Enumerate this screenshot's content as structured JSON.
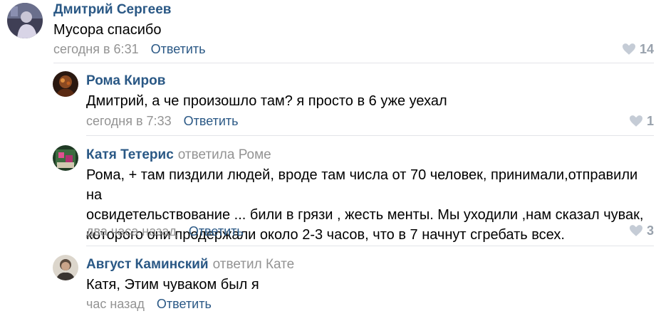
{
  "colors": {
    "author_link": "#2a5885",
    "meta_gray": "#939393",
    "like_gray": "#99a2ad",
    "divider": "#e3e4e8"
  },
  "comments": [
    {
      "author": "Дмитрий Сергеев",
      "reply_to": "",
      "text": "Мусора спасибо",
      "time": "сегодня в 6:31",
      "reply_label": "Ответить",
      "likes": "14",
      "avatar_icon": "user-avatar"
    },
    {
      "author": "Рома Киров",
      "reply_to": "",
      "text": "Дмитрий, а че произошло там? я просто в 6 уже уехал",
      "time": "сегодня в 7:33",
      "reply_label": "Ответить",
      "likes": "1",
      "avatar_icon": "user-avatar"
    },
    {
      "author": "Катя Тетерис",
      "reply_to": "ответила Роме",
      "text_lines": [
        "Рома, + там пиздили людей, вроде там числа от 70 человек, принимали,отправили на",
        "освидетельствование ... били в грязи , жесть менты. Мы уходили ,нам сказал чувак,",
        "которого они продержали около 2-3 часов, что в 7 начнут сгребать всех."
      ],
      "time": "два часа назад",
      "reply_label": "Ответить",
      "likes": "3",
      "avatar_icon": "user-avatar"
    },
    {
      "author": "Август Каминский",
      "reply_to": "ответил Кате",
      "text": "Катя, Этим чуваком был я",
      "time": "час назад",
      "reply_label": "Ответить",
      "likes": "",
      "avatar_icon": "user-avatar"
    }
  ]
}
